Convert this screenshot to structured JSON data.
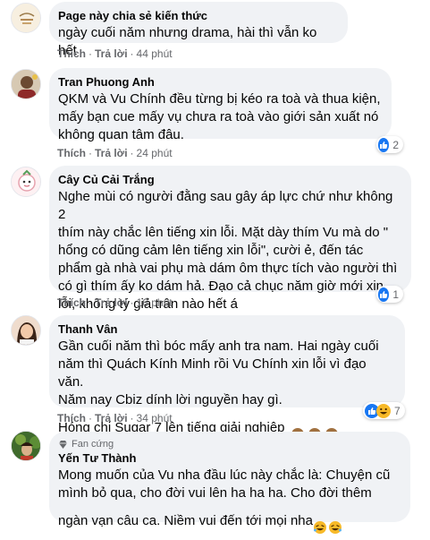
{
  "comments": [
    {
      "name": "Page này chia sẻ kiến thức",
      "text": "ngày cuối năm nhưng drama, hài thì vẫn ko hết",
      "like_label": "Thích",
      "reply_label": "Trả lời",
      "time": "44 phút",
      "reaction_count": ""
    },
    {
      "name": "Tran Phuong Anh",
      "text": "QKM và Vu Chính đều từng bị kéo ra toà và thua kiện,\nmấy bạn cue mấy vụ chưa ra toà vào giới sản xuất nó\nkhông quan tâm đâu.",
      "like_label": "Thích",
      "reply_label": "Trả lời",
      "time": "24 phút",
      "reaction_count": "2"
    },
    {
      "name": "Cây Củ Cải Trắng",
      "text": "Nghe mùi có người đằng sau gây áp lực chứ như không 2\nthím này chắc lên tiếng xin lỗi. Mặt dày thím Vu mà do \"\nhổng có dũng cảm lên tiếng xin lỗi\", cười ẻ, đến tác\nphẩm gà nhà vai phụ mà dám ôm thực tích vào người thì\ncó gì thím ấy ko dám hả. Đạo cả chục năm giờ mới xin\nlỗi, không tý giả trân nào hết á",
      "like_label": "Thích",
      "reply_label": "Trả lời",
      "time": "16 phút",
      "reaction_count": "1"
    },
    {
      "name": "Thanh Vân",
      "text": "Gần cuối năm thì bóc mấy anh tra nam. Hai ngày cuối\nnăm thì Quách Kính Minh rồi Vu Chính xin lỗi vì đạo văn.\nNăm nay Cbiz dính lời nguyền hay gì.\nHóng chị Sugar 7 lên tiếng giải nghiệp",
      "like_label": "Thích",
      "reply_label": "Trả lời",
      "time": "34 phút",
      "reaction_count": "7"
    },
    {
      "badge": "Fan cứng",
      "name": "Yến Tư Thành",
      "text": "Mong muốn của Vu nha đầu lúc này chắc là: Chuyện cũ\nmình bỏ qua, cho đời vui lên ha ha ha. Cho đời thêm\nngàn vạn câu ca. Niềm vui đến tới mọi nha",
      "reaction_count": ""
    }
  ],
  "icons": {
    "like": "like-icon",
    "haha": "haha-icon",
    "monkey": "see-no-evil-monkey-icon",
    "rofl": "rolling-laughing-icon",
    "fan_badge": "diamond-badge-icon"
  },
  "colors": {
    "bubble": "#f0f2f5",
    "meta_text": "#65676b",
    "like_blue": "#1877f2",
    "haha_yellow": "#f7b928"
  }
}
